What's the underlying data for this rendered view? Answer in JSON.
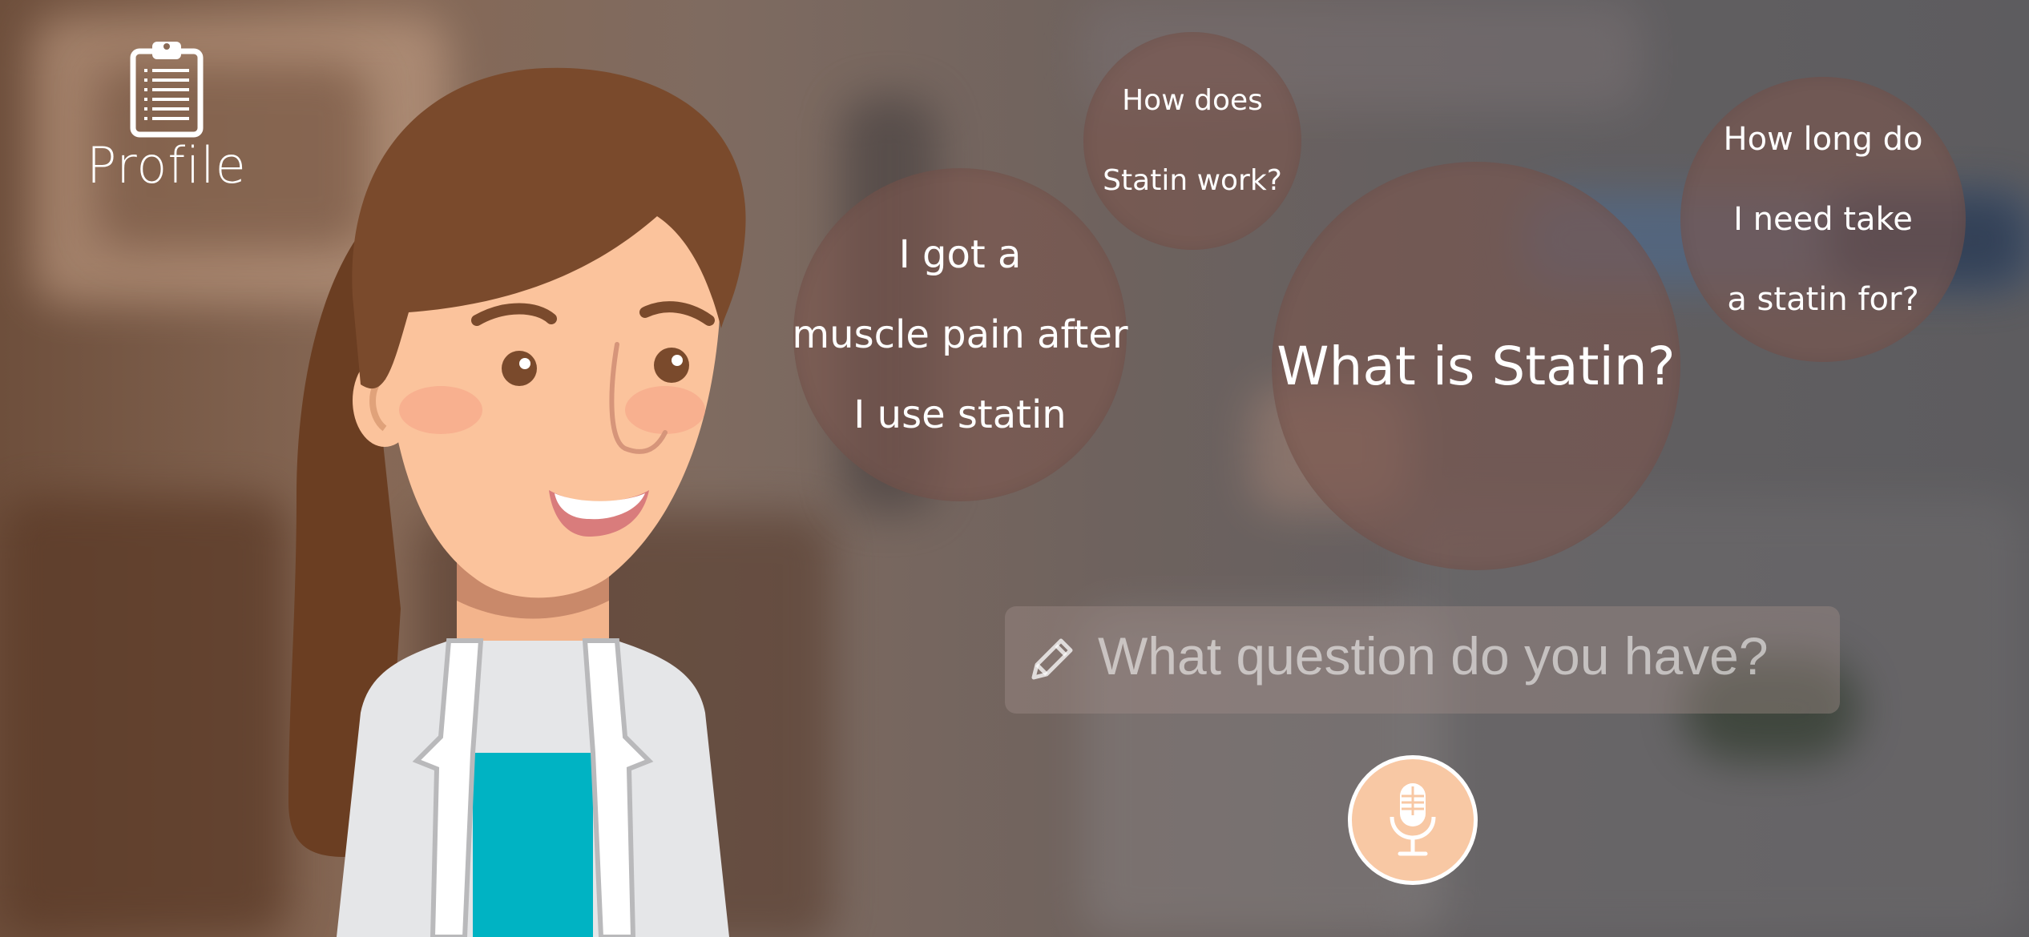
{
  "app": {
    "profile": {
      "label": "Profile",
      "icon": "clipboard-icon"
    }
  },
  "questions": [
    {
      "id": "muscle",
      "lines": [
        "I got a",
        "muscle pain after",
        "I use statin"
      ]
    },
    {
      "id": "how",
      "lines": [
        "How does",
        "Statin work?"
      ]
    },
    {
      "id": "what",
      "lines": [
        "What is Statin?"
      ]
    },
    {
      "id": "long",
      "lines": [
        "How long do",
        "I need take",
        "a statin for?"
      ]
    }
  ],
  "input": {
    "placeholder": "What question do you have?",
    "icon": "pencil-icon"
  },
  "mic": {
    "icon": "microphone-icon"
  },
  "colors": {
    "bubble": "#7a564e",
    "mic_fill": "#f8c8a4",
    "scrubs": "#00b3c3",
    "hair": "#7a4a2c",
    "skin": "#fbc39c"
  }
}
